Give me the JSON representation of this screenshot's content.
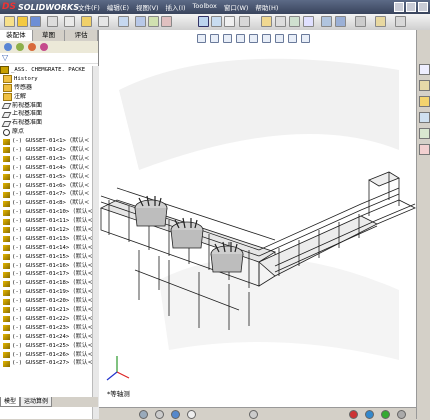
{
  "app": {
    "logo_text": "SOLIDWORKS",
    "logo_mark": "DS"
  },
  "menu": [
    "文件(F)",
    "编辑(E)",
    "视图(V)",
    "插入(I)",
    "Toolbox",
    "窗口(W)",
    "帮助(H)"
  ],
  "panel_tabs": [
    "装配体",
    "草图",
    "评估"
  ],
  "tree": {
    "root": "_ASS. CHEMGRATE. PACKE",
    "nodes": [
      "History",
      "传感器",
      "注解",
      "前视基准面",
      "上视基准面",
      "右视基准面",
      "原点"
    ],
    "gussets": [
      "(-) GUSSET-01<1>",
      "(-) GUSSET-01<2>",
      "(-) GUSSET-01<3>",
      "(-) GUSSET-01<4>",
      "(-) GUSSET-01<5>",
      "(-) GUSSET-01<6>",
      "(-) GUSSET-01<7>",
      "(-) GUSSET-01<8>",
      "(-) GUSSET-01<10>",
      "(-) GUSSET-01<11>",
      "(-) GUSSET-01<12>",
      "(-) GUSSET-01<13>",
      "(-) GUSSET-01<14>",
      "(-) GUSSET-01<15>",
      "(-) GUSSET-01<16>",
      "(-) GUSSET-01<17>",
      "(-) GUSSET-01<18>",
      "(-) GUSSET-01<19>",
      "(-) GUSSET-01<20>",
      "(-) GUSSET-01<21>",
      "(-) GUSSET-01<22>",
      "(-) GUSSET-01<23>",
      "(-) GUSSET-01<24>",
      "(-) GUSSET-01<25>",
      "(-) GUSSET-01<26>",
      "(-) GUSSET-01<27>"
    ],
    "gusset_suffix": "(默认<"
  },
  "bottom_tabs": [
    "模型",
    "运动算例"
  ],
  "view_label": "*等轴测",
  "colors": {
    "title_bar": "#39445c",
    "structure": "#222222"
  }
}
